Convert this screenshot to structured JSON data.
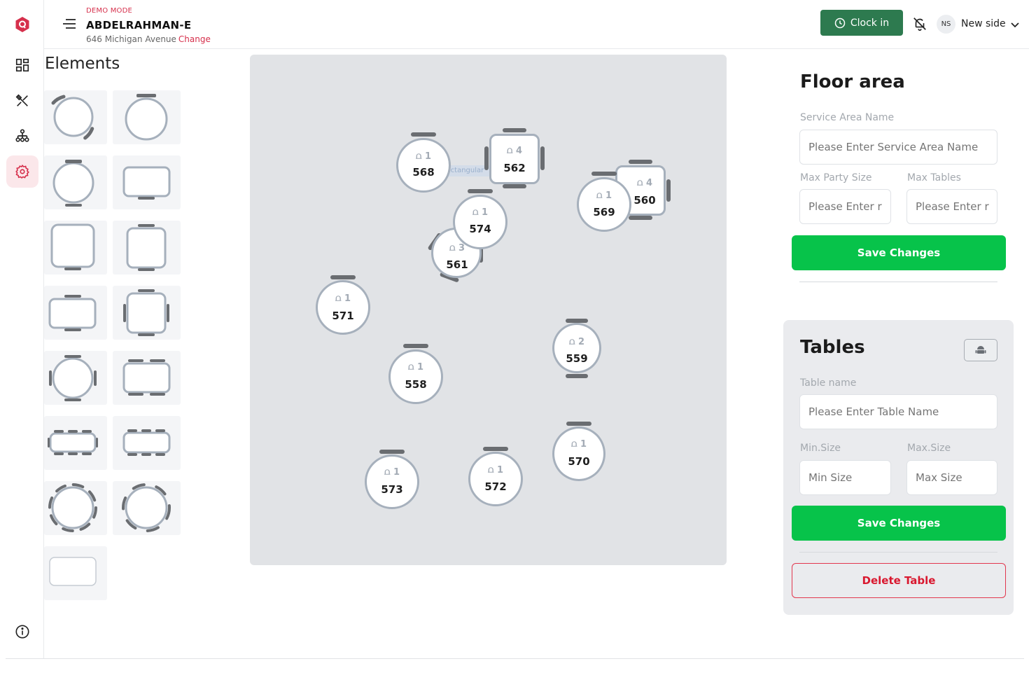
{
  "header": {
    "demo_label": "DEMO MODE",
    "restaurant_name": "ABDELRAHMAN-E",
    "address": "646 Michigan Avenue",
    "change_link": "Change",
    "clock_in_label": "Clock in",
    "user_initials": "NS",
    "user_name": "New side"
  },
  "sidebar": {
    "items": [
      {
        "icon": "dashboard-icon"
      },
      {
        "icon": "utensils-icon"
      },
      {
        "icon": "org-chart-icon"
      },
      {
        "icon": "settings-gear-icon",
        "active": true
      }
    ],
    "bottom_icon": "info-icon"
  },
  "elements": {
    "title": "Elements",
    "tiles": [
      {
        "shape": "round-2-chairs-diag"
      },
      {
        "shape": "round-1-chair"
      },
      {
        "shape": "round-2-chairs"
      },
      {
        "shape": "rect-1-chair"
      },
      {
        "shape": "square-1-chair"
      },
      {
        "shape": "square-2-chairs"
      },
      {
        "shape": "rect-2-chairs"
      },
      {
        "shape": "square-4-chairs"
      },
      {
        "shape": "round-4-chairs"
      },
      {
        "shape": "rect-4-chairs"
      },
      {
        "shape": "long-rect-6-chairs"
      },
      {
        "shape": "long-rect-6-chairs"
      },
      {
        "shape": "round-ring"
      },
      {
        "shape": "round-ring-open"
      },
      {
        "shape": "plain-rect"
      }
    ]
  },
  "floor": {
    "ghost_label": "Rectangular",
    "tables": [
      {
        "name": "568",
        "count": "1"
      },
      {
        "name": "562",
        "count": "4"
      },
      {
        "name": "560",
        "count": "4"
      },
      {
        "name": "569",
        "count": "1"
      },
      {
        "name": "574",
        "count": "1"
      },
      {
        "name": "561",
        "count": "3"
      },
      {
        "name": "571",
        "count": "1"
      },
      {
        "name": "559",
        "count": "2"
      },
      {
        "name": "558",
        "count": "1"
      },
      {
        "name": "570",
        "count": "1"
      },
      {
        "name": "573",
        "count": "1"
      },
      {
        "name": "572",
        "count": "1"
      }
    ]
  },
  "floor_area": {
    "title": "Floor area",
    "service_area_label": "Service Area Name",
    "service_area_placeholder": "Please Enter Service Area Name",
    "max_party_label": "Max Party Size",
    "max_party_placeholder": "Please Enter r",
    "max_tables_label": "Max Tables",
    "max_tables_placeholder": "Please Enter r",
    "save_label": "Save Changes"
  },
  "tables_panel": {
    "title": "Tables",
    "table_name_label": "Table name",
    "table_name_placeholder": "Please Enter Table Name",
    "min_label": "Min.Size",
    "min_placeholder": "Min Size",
    "max_label": "Max.Size",
    "max_placeholder": "Max Size",
    "save_label": "Save Changes",
    "delete_label": "Delete Table"
  },
  "colors": {
    "brand": "#d6304c",
    "clock_in": "#2d7a4f",
    "save": "#07c34a",
    "delete": "#d9182f"
  }
}
